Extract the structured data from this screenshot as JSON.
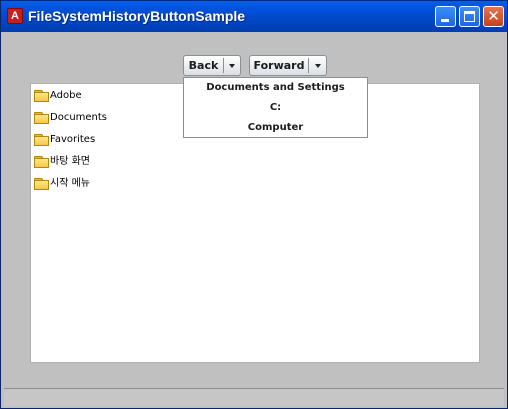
{
  "window": {
    "title": "FileSystemHistoryButtonSample",
    "app_icon_glyph": "A",
    "close_glyph": "✕"
  },
  "toolbar": {
    "back_label": "Back",
    "forward_label": "Forward"
  },
  "file_list": {
    "items": [
      {
        "label": "Adobe",
        "icon": "folder-icon"
      },
      {
        "label": "Documents",
        "icon": "folder-icon"
      },
      {
        "label": "Favorites",
        "icon": "folder-icon"
      },
      {
        "label": "바탕 화면",
        "icon": "folder-icon"
      },
      {
        "label": "시작 메뉴",
        "icon": "folder-icon"
      }
    ]
  },
  "history_dropdown": {
    "items": [
      {
        "label": "Documents and Settings"
      },
      {
        "label": "C:"
      },
      {
        "label": "Computer"
      }
    ]
  },
  "colors": {
    "titlebar": "#0054e3",
    "window_bg": "#c0c0c0",
    "close_button": "#e8734f"
  }
}
